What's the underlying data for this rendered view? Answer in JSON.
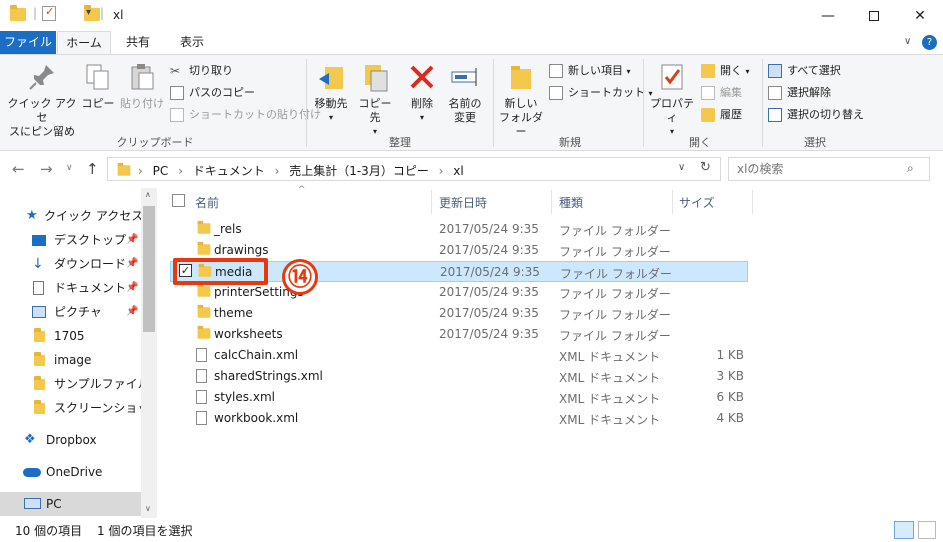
{
  "window": {
    "title": "xl",
    "minimize_icon": "minimize-icon",
    "maximize_icon": "maximize-icon",
    "close_icon": "close-icon"
  },
  "ribbon_tabs": {
    "file": "ファイル",
    "home": "ホーム",
    "share": "共有",
    "view": "表示"
  },
  "ribbon": {
    "clipboard": {
      "pin_quick_access": "クイック アクセ\nスにピン留め",
      "copy": "コピー",
      "paste": "貼り付け",
      "cut": "切り取り",
      "copy_path": "パスのコピー",
      "paste_shortcut": "ショートカットの貼り付け",
      "label": "クリップボード"
    },
    "organize": {
      "move_to": "移動先",
      "copy_to": "コピー先",
      "delete": "削除",
      "rename": "名前の\n変更",
      "label": "整理"
    },
    "new": {
      "new_folder": "新しい\nフォルダー",
      "new_item": "新しい項目",
      "shortcut": "ショートカット",
      "label": "新規"
    },
    "open": {
      "properties": "プロパティ",
      "open": "開く",
      "edit": "編集",
      "history": "履歴",
      "label": "開く"
    },
    "select": {
      "select_all": "すべて選択",
      "select_none": "選択解除",
      "invert": "選択の切り替え",
      "label": "選択"
    }
  },
  "address": {
    "crumbs": [
      "PC",
      "ドキュメント",
      "売上集計（1-3月）コピー",
      "xl"
    ],
    "search_placeholder": "xlの検索"
  },
  "nav": {
    "quick_access": "クイック アクセス",
    "items": [
      {
        "label": "デスクトップ",
        "pinned": true
      },
      {
        "label": "ダウンロード",
        "pinned": true
      },
      {
        "label": "ドキュメント",
        "pinned": true
      },
      {
        "label": "ピクチャ",
        "pinned": true
      },
      {
        "label": "1705",
        "pinned": false
      },
      {
        "label": "image",
        "pinned": false
      },
      {
        "label": "サンプルファイル",
        "pinned": false
      },
      {
        "label": "スクリーンショット",
        "pinned": false
      }
    ],
    "dropbox": "Dropbox",
    "onedrive": "OneDrive",
    "pc": "PC"
  },
  "columns": {
    "name": "名前",
    "date": "更新日時",
    "type": "種類",
    "size": "サイズ"
  },
  "files": [
    {
      "name": "_rels",
      "date": "2017/05/24 9:35",
      "type": "ファイル フォルダー",
      "size": "",
      "kind": "folder"
    },
    {
      "name": "drawings",
      "date": "2017/05/24 9:35",
      "type": "ファイル フォルダー",
      "size": "",
      "kind": "folder"
    },
    {
      "name": "media",
      "date": "2017/05/24 9:35",
      "type": "ファイル フォルダー",
      "size": "",
      "kind": "folder",
      "selected": true
    },
    {
      "name": "printerSettings",
      "date": "2017/05/24 9:35",
      "type": "ファイル フォルダー",
      "size": "",
      "kind": "folder"
    },
    {
      "name": "theme",
      "date": "2017/05/24 9:35",
      "type": "ファイル フォルダー",
      "size": "",
      "kind": "folder"
    },
    {
      "name": "worksheets",
      "date": "2017/05/24 9:35",
      "type": "ファイル フォルダー",
      "size": "",
      "kind": "folder"
    },
    {
      "name": "calcChain.xml",
      "date": "",
      "type": "XML ドキュメント",
      "size": "1 KB",
      "kind": "file"
    },
    {
      "name": "sharedStrings.xml",
      "date": "",
      "type": "XML ドキュメント",
      "size": "3 KB",
      "kind": "file"
    },
    {
      "name": "styles.xml",
      "date": "",
      "type": "XML ドキュメント",
      "size": "6 KB",
      "kind": "file"
    },
    {
      "name": "workbook.xml",
      "date": "",
      "type": "XML ドキュメント",
      "size": "4 KB",
      "kind": "file"
    }
  ],
  "annotation": {
    "number": "⑭",
    "color": "#e8380d"
  },
  "status": {
    "item_count": "10 個の項目",
    "selected_count": "1 個の項目を選択"
  },
  "colors": {
    "accent": "#1a6ec6",
    "selection": "#cce8ff",
    "folder": "#f3c84c"
  }
}
